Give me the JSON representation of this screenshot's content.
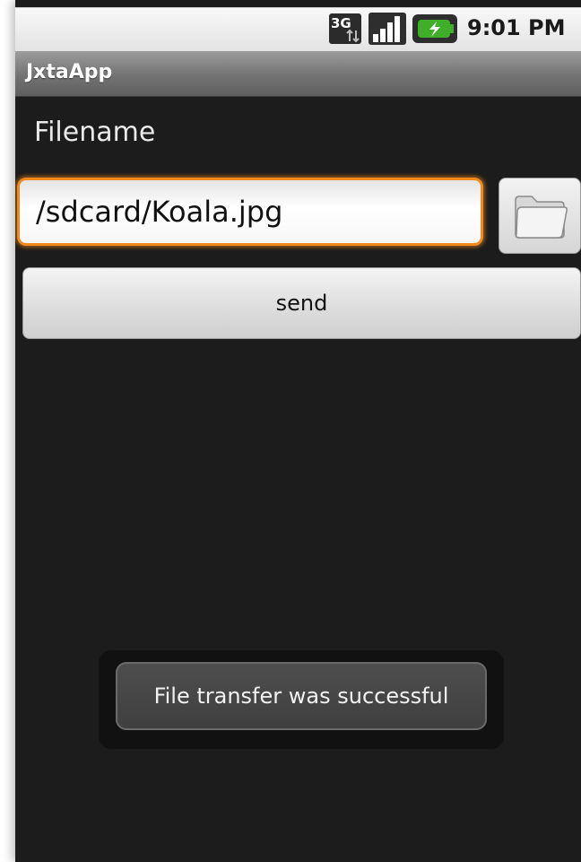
{
  "status_bar": {
    "network_badge": "3G",
    "network_icon": "3g-data-icon",
    "signal_icon": "signal-strength-icon",
    "battery_icon": "battery-charging-icon",
    "time": "9:01 PM"
  },
  "app": {
    "title": "JxtaApp"
  },
  "form": {
    "filename_label": "Filename",
    "filename_value": "/sdcard/Koala.jpg",
    "browse_icon": "folder-icon",
    "send_label": "send"
  },
  "toast": {
    "message": "File transfer was successful"
  },
  "colors": {
    "background": "#1c1c1c",
    "focus_accent": "#f08a1c",
    "battery_green": "#3fae29"
  }
}
